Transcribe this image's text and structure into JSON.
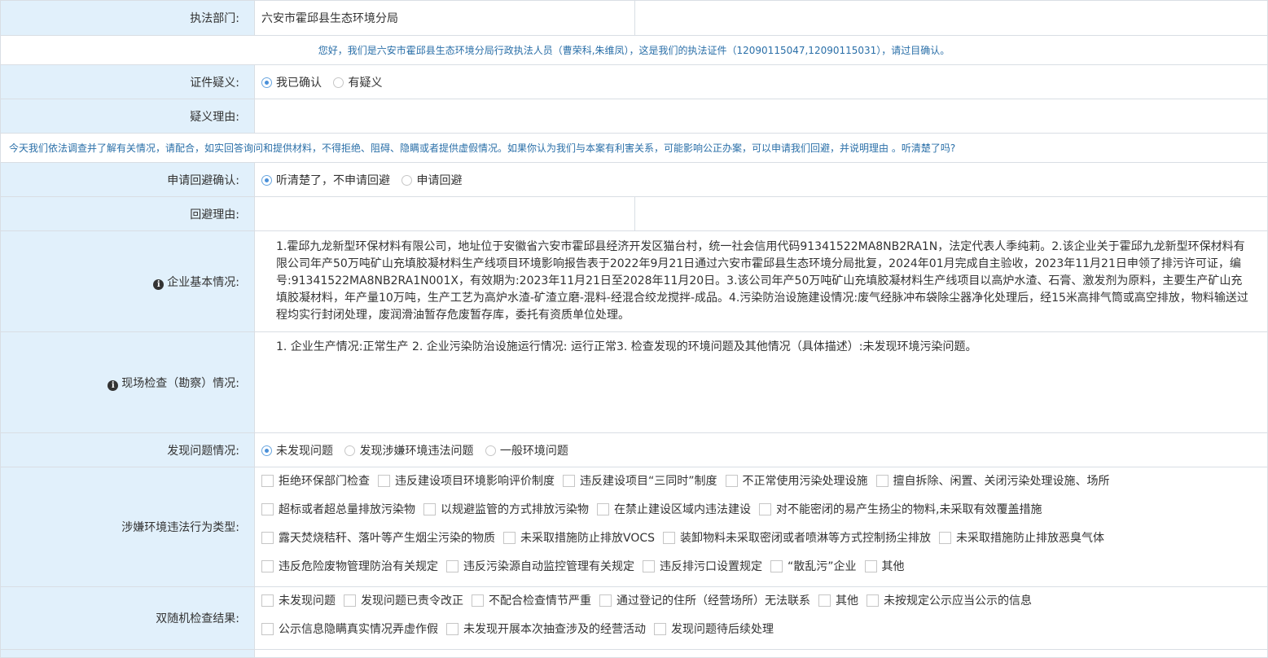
{
  "rows": {
    "dept": {
      "label": "执法部门:",
      "value": "六安市霍邱县生态环境分局"
    },
    "notice1": "您好，我们是六安市霍邱县生态环境分局行政执法人员（曹荣科,朱维凤），这是我们的执法证件（12090115047,12090115031），请过目确认。",
    "cert": {
      "label": "证件疑义:",
      "options": [
        "我已确认",
        "有疑义"
      ],
      "selected": 0
    },
    "doubt_reason": {
      "label": "疑义理由:"
    },
    "notice2": "今天我们依法调查并了解有关情况，请配合，如实回答询问和提供材料，不得拒绝、阻碍、隐瞒或者提供虚假情况。如果你认为我们与本案有利害关系，可能影响公正办案，可以申请我们回避，并说明理由 。听清楚了吗?",
    "avoid_confirm": {
      "label": "申请回避确认:",
      "options": [
        "听清楚了，不申请回避",
        "申请回避"
      ],
      "selected": 0
    },
    "avoid_reason": {
      "label": "回避理由:"
    },
    "company": {
      "label": "企业基本情况:",
      "text": "1.霍邱九龙新型环保材料有限公司，地址位于安徽省六安市霍邱县经济开发区猫台村，统一社会信用代码91341522MA8NB2RA1N，法定代表人季纯莉。2.该企业关于霍邱九龙新型环保材料有限公司年产50万吨矿山充填胶凝材料生产线项目环境影响报告表于2022年9月21日通过六安市霍邱县生态环境分局批复，2024年01月完成自主验收，2023年11月21日申领了排污许可证，编号:91341522MA8NB2RA1N001X，有效期为:2023年11月21日至2028年11月20日。3.该公司年产50万吨矿山充填胶凝材料生产线项目以高炉水渣、石膏、激发剂为原料，主要生产矿山充填胶凝材料，年产量10万吨，生产工艺为高炉水渣-矿渣立磨-混料-经混合绞龙搅拌-成品。4.污染防治设施建设情况:废气经脉冲布袋除尘器净化处理后，经15米高排气筒或高空排放，物料输送过程均实行封闭处理，废润滑油暂存危废暂存库，委托有资质单位处理。"
    },
    "inspection": {
      "label": "现场检查（勘察）情况:",
      "text": "1. 企业生产情况:正常生产  2. 企业污染防治设施运行情况: 运行正常3. 检查发现的环境问题及其他情况（具体描述）:未发现环境污染问题。"
    },
    "problems": {
      "label": "发现问题情况:",
      "options": [
        "未发现问题",
        "发现涉嫌环境违法问题",
        "一般环境问题"
      ],
      "selected": 0
    },
    "violation": {
      "label": "涉嫌环境违法行为类型:",
      "lines": [
        [
          "拒绝环保部门检查",
          "违反建设项目环境影响评价制度",
          "违反建设项目“三同时”制度",
          "不正常使用污染处理设施",
          "擅自拆除、闲置、关闭污染处理设施、场所"
        ],
        [
          "超标或者超总量排放污染物",
          "以规避监管的方式排放污染物",
          "在禁止建设区域内违法建设",
          "对不能密闭的易产生扬尘的物料,未采取有效覆盖措施"
        ],
        [
          "露天焚烧秸秆、落叶等产生烟尘污染的物质",
          "未采取措施防止排放VOCS",
          "装卸物料未采取密闭或者喷淋等方式控制扬尘排放",
          "未采取措施防止排放恶臭气体"
        ],
        [
          "违反危险废物管理防治有关规定",
          "违反污染源自动监控管理有关规定",
          "违反排污口设置规定",
          "“散乱污”企业",
          "其他"
        ]
      ]
    },
    "random": {
      "label": "双随机检查结果:",
      "lines": [
        [
          "未发现问题",
          "发现问题已责令改正",
          "不配合检查情节严重",
          "通过登记的住所（经营场所）无法联系",
          "其他",
          "未按规定公示应当公示的信息"
        ],
        [
          "公示信息隐瞒真实情况弄虚作假",
          "未发现开展本次抽查涉及的经营活动",
          "发现问题待后续处理"
        ]
      ]
    }
  },
  "colors": {
    "label_bg": "#e1f0fb",
    "notice_text": "#2a6fa8",
    "border": "#d9dee4"
  },
  "icons": {
    "info": "info-circle-icon"
  }
}
